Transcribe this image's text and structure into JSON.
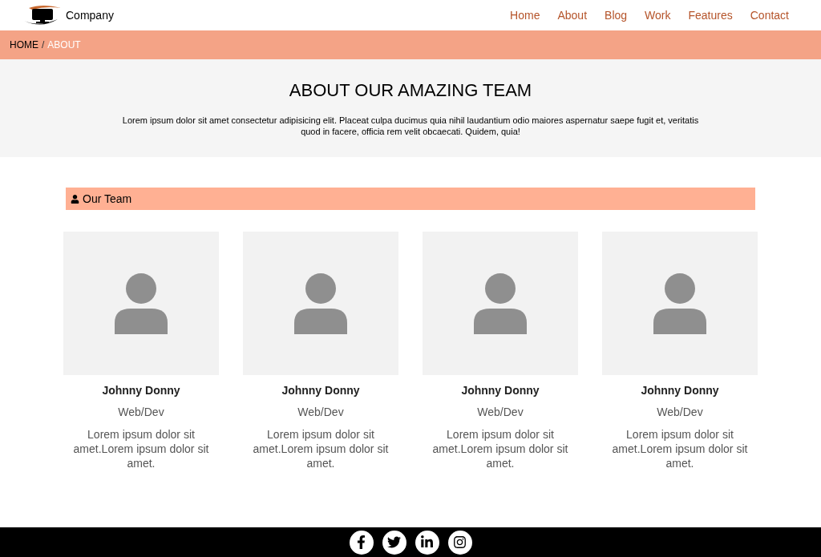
{
  "header": {
    "brand": "Company",
    "nav": [
      "Home",
      "About",
      "Blog",
      "Work",
      "Features",
      "Contact"
    ]
  },
  "breadcrumb": {
    "items": [
      {
        "label": "HOME",
        "selected": false
      },
      {
        "label": "ABOUT",
        "selected": true
      }
    ],
    "separator": "/"
  },
  "hero": {
    "title": "ABOUT OUR AMAZING TEAM",
    "text": "Lorem ipsum dolor sit amet consectetur adipisicing elit. Placeat culpa ducimus quia nihil laudantium odio maiores aspernatur saepe fugit et, veritatis quod in facere, officia rem velit obcaecati. Quidem, quia!"
  },
  "section": {
    "title": "Our Team"
  },
  "team": [
    {
      "name": "Johnny Donny",
      "role": "Web/Dev",
      "bio": "Lorem ipsum dolor sit amet.Lorem ipsum dolor sit amet."
    },
    {
      "name": "Johnny Donny",
      "role": "Web/Dev",
      "bio": "Lorem ipsum dolor sit amet.Lorem ipsum dolor sit amet."
    },
    {
      "name": "Johnny Donny",
      "role": "Web/Dev",
      "bio": "Lorem ipsum dolor sit amet.Lorem ipsum dolor sit amet."
    },
    {
      "name": "Johnny Donny",
      "role": "Web/Dev",
      "bio": "Lorem ipsum dolor sit amet.Lorem ipsum dolor sit amet."
    }
  ],
  "footer": {
    "social": [
      {
        "kind": "facebook"
      },
      {
        "kind": "twitter"
      },
      {
        "kind": "linkedin"
      },
      {
        "kind": "instagram"
      }
    ]
  }
}
